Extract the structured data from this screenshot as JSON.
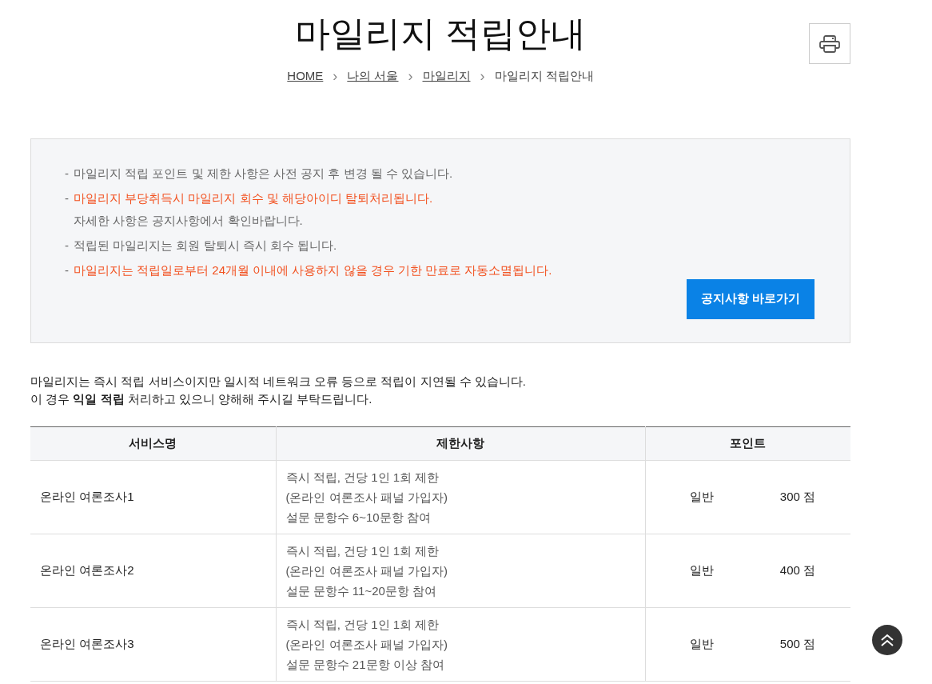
{
  "title": "마일리지 적립안내",
  "breadcrumb": [
    {
      "label": "HOME",
      "link": true
    },
    {
      "label": "나의 서울",
      "link": true
    },
    {
      "label": "마일리지",
      "link": true
    },
    {
      "label": "마일리지 적립안내",
      "link": false
    }
  ],
  "breadcrumb_separator": "›",
  "notices": [
    {
      "text": "마일리지 적립 포인트 및 제한 사항은 사전 공지 후 변경 될 수 있습니다.",
      "highlighted": false
    },
    {
      "text": "마일리지 부당취득시 마일리지 회수 및 해당아이디 탈퇴처리됩니다.",
      "highlighted": true,
      "note": "자세한 사항은 공지사항에서 확인바랍니다."
    },
    {
      "text": "적립된 마일리지는 회원 탈퇴시 즉시 회수 됩니다.",
      "highlighted": false
    },
    {
      "text": "마일리지는 적립일로부터 24개월 이내에 사용하지 않을 경우 기한 만료로 자동소멸됩니다.",
      "highlighted": true
    }
  ],
  "notice_bullet": "-",
  "notice_button": "공지사항 바로가기",
  "intro": [
    "마일리지는 즉시 적립 서비스이지만 일시적 네트워크 오류 등으로 적립이 지연될 수 있습니다.",
    "이 경우 **익일 적립** 처리하고 있으니 양해해 주시길 부탁드립니다."
  ],
  "table": {
    "columns": [
      "서비스명",
      "제한사항",
      "포인트"
    ],
    "rows": [
      {
        "service": "온라인 여론조사1",
        "restrictions": [
          "즉시 적립, 건당 1인 1회 제한",
          "(온라인 여론조사 패널 가입자)",
          "설문 문항수 6~10문항 참여"
        ],
        "grade": "일반",
        "points": "300 점"
      },
      {
        "service": "온라인 여론조사2",
        "restrictions": [
          "즉시 적립, 건당 1인 1회 제한",
          "(온라인 여론조사 패널 가입자)",
          "설문 문항수 11~20문항 참여"
        ],
        "grade": "일반",
        "points": "400 점"
      },
      {
        "service": "온라인 여론조사3",
        "restrictions": [
          "즉시 적립, 건당 1인 1회 제한",
          "(온라인 여론조사 패널 가입자)",
          "설문 문항수 21문항 이상 참여"
        ],
        "grade": "일반",
        "points": "500 점"
      }
    ]
  }
}
